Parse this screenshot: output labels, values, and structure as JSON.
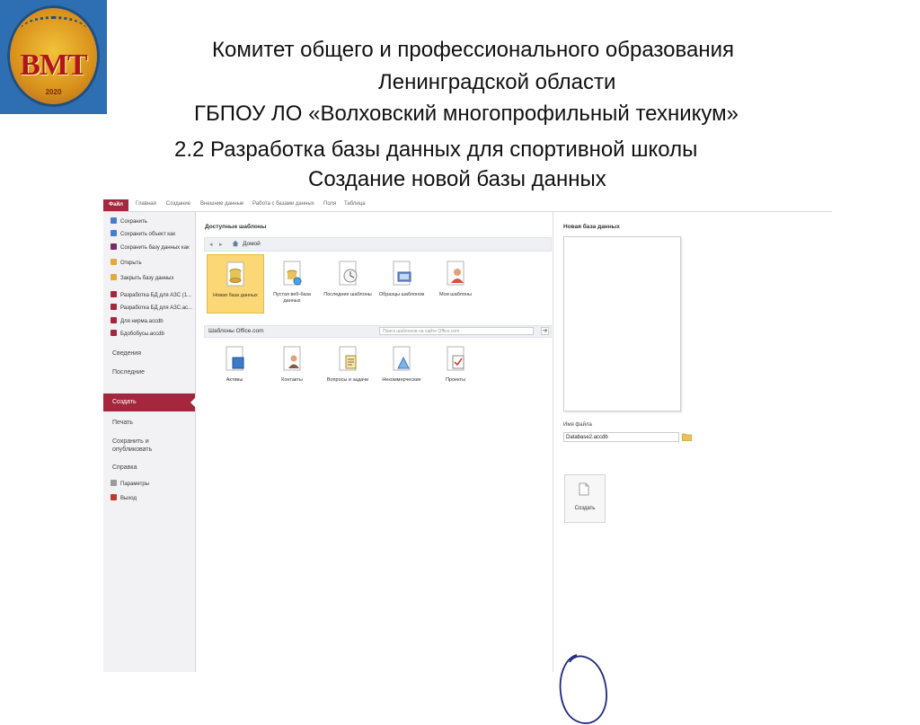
{
  "slide": {
    "logo_text": "ВМТ",
    "logo_year": "2020",
    "header_lines": [
      "Комитет общего и профессионального образования",
      "Ленинградской области",
      "ГБПОУ ЛО  «Волховский многопрофильный техникум»",
      "2.2 Разработка базы данных для спортивной школы",
      "Создание новой базы данных"
    ]
  },
  "app": {
    "ribbon_tabs": [
      "Файл",
      "Главная",
      "Создание",
      "Внешние данные",
      "Работа с базами данных",
      "Поля",
      "Таблица"
    ],
    "backstage": {
      "commands": [
        {
          "label": "Сохранить",
          "icon": "save-icon",
          "color": "#4a7cc9"
        },
        {
          "label": "Сохранить объект как",
          "icon": "save-as-icon",
          "color": "#4a7cc9"
        },
        {
          "label": "Сохранить базу данных как",
          "icon": "save-db-icon",
          "color": "#7a2a6a"
        },
        {
          "label": "Открыть",
          "icon": "folder-open-icon",
          "color": "#e2a93b"
        },
        {
          "label": "Закрыть базу данных",
          "icon": "close-db-icon",
          "color": "#e2a93b"
        }
      ],
      "recent_files": [
        {
          "label": "Разработка БД для АЗС (1...",
          "icon": "access-file-icon",
          "color": "#a4273d"
        },
        {
          "label": "Разработка БД для АЗС.ас...",
          "icon": "access-file-icon",
          "color": "#a4273d"
        },
        {
          "label": "Для нирма.accdb",
          "icon": "access-file-icon",
          "color": "#a4273d"
        },
        {
          "label": "Бдобобусы.accdb",
          "icon": "access-file-icon",
          "color": "#a4273d"
        }
      ],
      "sections": {
        "info": "Сведения",
        "recent": "Последние",
        "new": "Создать",
        "print": "Печать",
        "save_publish": "Сохранить и опубликовать",
        "help": "Справка"
      },
      "bottom_commands": [
        {
          "label": "Параметры",
          "icon": "options-icon",
          "color": "#777777"
        },
        {
          "label": "Выход",
          "icon": "exit-icon",
          "color": "#c0392b"
        }
      ]
    },
    "templates": {
      "title": "Доступные шаблоны",
      "nav_home": "Домой",
      "local": [
        {
          "label": "Новая база данных",
          "icon": "blank-database-icon",
          "selected": true
        },
        {
          "label": "Пустая веб-база данных",
          "icon": "web-database-icon",
          "selected": false
        },
        {
          "label": "Последние шаблоны",
          "icon": "recent-templates-icon",
          "selected": false
        },
        {
          "label": "Образцы шаблонов",
          "icon": "sample-templates-icon",
          "selected": false
        },
        {
          "label": "Мои шаблоны",
          "icon": "my-templates-icon",
          "selected": false
        }
      ],
      "office_label": "Шаблоны Office.com",
      "search_placeholder": "Поиск шаблонов на сайте Office.com",
      "search_button": "➜",
      "office": [
        {
          "label": "Активы",
          "icon": "assets-icon"
        },
        {
          "label": "Контакты",
          "icon": "contacts-icon"
        },
        {
          "label": "Вопросы и задачи",
          "icon": "issues-tasks-icon"
        },
        {
          "label": "Некоммерческие",
          "icon": "nonprofit-icon"
        },
        {
          "label": "Проекты",
          "icon": "projects-icon"
        }
      ]
    },
    "right_panel": {
      "title": "Новая база данных",
      "file_name_label": "Имя файла",
      "file_name_value": "Database2.accdb",
      "create_label": "Создать"
    },
    "colors": {
      "accent": "#a4273d",
      "selected_tile": "#fbd775",
      "annotation": "#1f2a7a"
    }
  }
}
